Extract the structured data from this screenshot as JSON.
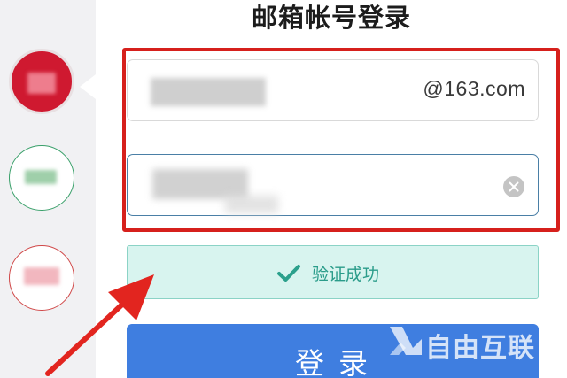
{
  "title": "邮箱帐号登录",
  "email": {
    "domain_suffix": "@163.com"
  },
  "verify": {
    "label": "验证成功"
  },
  "login": {
    "label": "登录"
  },
  "watermark": {
    "text": "自由互联"
  },
  "icons": {
    "clear": "clear-icon",
    "check": "check-icon",
    "annotation_arrow": "arrow-icon"
  },
  "colors": {
    "highlight_frame": "#d6201c",
    "verify_bg": "#d8f4ef",
    "verify_text": "#2a9c8a",
    "login_bg": "#3f7ee0",
    "account_1": "#cf1930",
    "account_2": "#3aa06a",
    "account_3": "#d04848"
  }
}
